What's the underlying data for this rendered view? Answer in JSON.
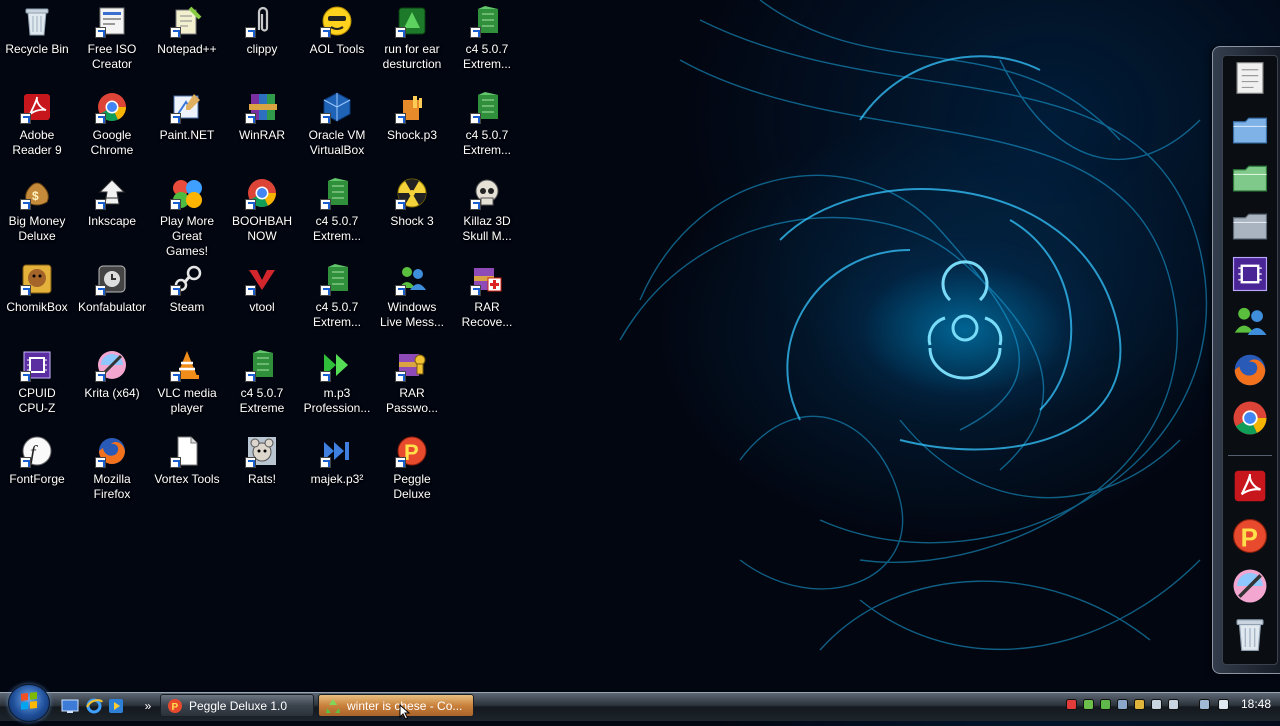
{
  "desktop_icons": [
    {
      "label": "Recycle Bin",
      "icon": "recycle-bin-icon"
    },
    {
      "label": "Free ISO\nCreator",
      "icon": "iso-creator-icon"
    },
    {
      "label": "Notepad++",
      "icon": "notepad-plus-icon"
    },
    {
      "label": "clippy",
      "icon": "paperclip-icon"
    },
    {
      "label": "AOL Tools",
      "icon": "aol-icon"
    },
    {
      "label": "run for ear\ndesturction",
      "icon": "game-icon"
    },
    {
      "label": "c4 5.0.7\nExtrem...",
      "icon": "c4-icon"
    },
    {
      "label": "Adobe\nReader 9",
      "icon": "adobe-reader-icon"
    },
    {
      "label": "Google\nChrome",
      "icon": "chrome-icon"
    },
    {
      "label": "Paint.NET",
      "icon": "paintnet-icon"
    },
    {
      "label": "WinRAR",
      "icon": "winrar-icon"
    },
    {
      "label": "Oracle VM\nVirtualBox",
      "icon": "virtualbox-icon"
    },
    {
      "label": "Shock.p3",
      "icon": "p3-file-icon"
    },
    {
      "label": "c4 5.0.7\nExtrem...",
      "icon": "c4-icon"
    },
    {
      "label": "Big Money\nDeluxe",
      "icon": "money-bag-icon"
    },
    {
      "label": "Inkscape",
      "icon": "inkscape-icon"
    },
    {
      "label": "Play More\nGreat Games!",
      "icon": "games-icon"
    },
    {
      "label": "BOOHBAH\nNOW",
      "icon": "chrome-icon"
    },
    {
      "label": "c4 5.0.7\nExtrem...",
      "icon": "c4-icon"
    },
    {
      "label": "Shock 3",
      "icon": "radiation-icon"
    },
    {
      "label": "Killaz 3D\nSkull M...",
      "icon": "skull-icon"
    },
    {
      "label": "ChomikBox",
      "icon": "chomikbox-icon"
    },
    {
      "label": "Konfabulator",
      "icon": "konfabulator-icon"
    },
    {
      "label": "Steam",
      "icon": "steam-icon"
    },
    {
      "label": "vtool",
      "icon": "vtool-icon"
    },
    {
      "label": "c4 5.0.7\nExtrem...",
      "icon": "c4-icon"
    },
    {
      "label": "Windows\nLive Mess...",
      "icon": "messenger-icon"
    },
    {
      "label": "RAR\nRecove...",
      "icon": "rar-recovery-icon"
    },
    {
      "label": "CPUID\nCPU-Z",
      "icon": "cpuz-icon"
    },
    {
      "label": "Krita (x64)",
      "icon": "krita-icon"
    },
    {
      "label": "VLC media\nplayer",
      "icon": "vlc-icon"
    },
    {
      "label": "c4 5.0.7\nExtreme",
      "icon": "c4-icon"
    },
    {
      "label": "m.p3\nProfession...",
      "icon": "p3-arrow-icon"
    },
    {
      "label": "RAR\nPasswo...",
      "icon": "rar-password-icon"
    },
    {
      "label": "FontForge",
      "icon": "fontforge-icon"
    },
    {
      "label": "Mozilla\nFirefox",
      "icon": "firefox-icon"
    },
    {
      "label": "Vortex Tools",
      "icon": "document-icon"
    },
    {
      "label": "Rats!",
      "icon": "rats-icon"
    },
    {
      "label": "majek.p3²",
      "icon": "majek-icon"
    },
    {
      "label": "Peggle\nDeluxe",
      "icon": "peggle-icon"
    }
  ],
  "dock_items": [
    {
      "icon": "notepad-icon"
    },
    {
      "icon": "folder-icon"
    },
    {
      "icon": "folder-green-icon"
    },
    {
      "icon": "folder-gray-icon"
    },
    {
      "icon": "cpu-chip-icon"
    },
    {
      "icon": "messenger-icon"
    },
    {
      "icon": "firefox-icon"
    },
    {
      "icon": "chrome-icon"
    },
    {
      "icon": "adobe-reader-icon"
    },
    {
      "icon": "peggle-icon"
    },
    {
      "icon": "krita-icon"
    },
    {
      "icon": "recycle-bin-icon"
    }
  ],
  "taskbar": {
    "start_icon": "windows-logo-icon",
    "quick_launch": [
      {
        "icon": "show-desktop-icon"
      },
      {
        "icon": "internet-explorer-icon"
      },
      {
        "icon": "media-player-icon"
      },
      {
        "icon": "chevron-icon",
        "label": "»"
      }
    ],
    "tasks": [
      {
        "label": "Peggle Deluxe 1.0",
        "icon": "peggle-icon",
        "active": false
      },
      {
        "label": "winter is chese - Co...",
        "icon": "recycle-small-icon",
        "active": true
      }
    ],
    "tray_icons": [
      "security-alert-icon",
      "network-user-icon",
      "shield-check-icon",
      "network-icon",
      "lock-icon",
      "display-icon",
      "monitor-icon",
      "network-computer-icon",
      "volume-icon"
    ],
    "clock": "18:48"
  },
  "colors": {
    "desktop_bg": "#020611",
    "wallpaper_glow": "#0a9fd8",
    "taskbar": "#1d242b",
    "active_task": "#c9813c"
  }
}
